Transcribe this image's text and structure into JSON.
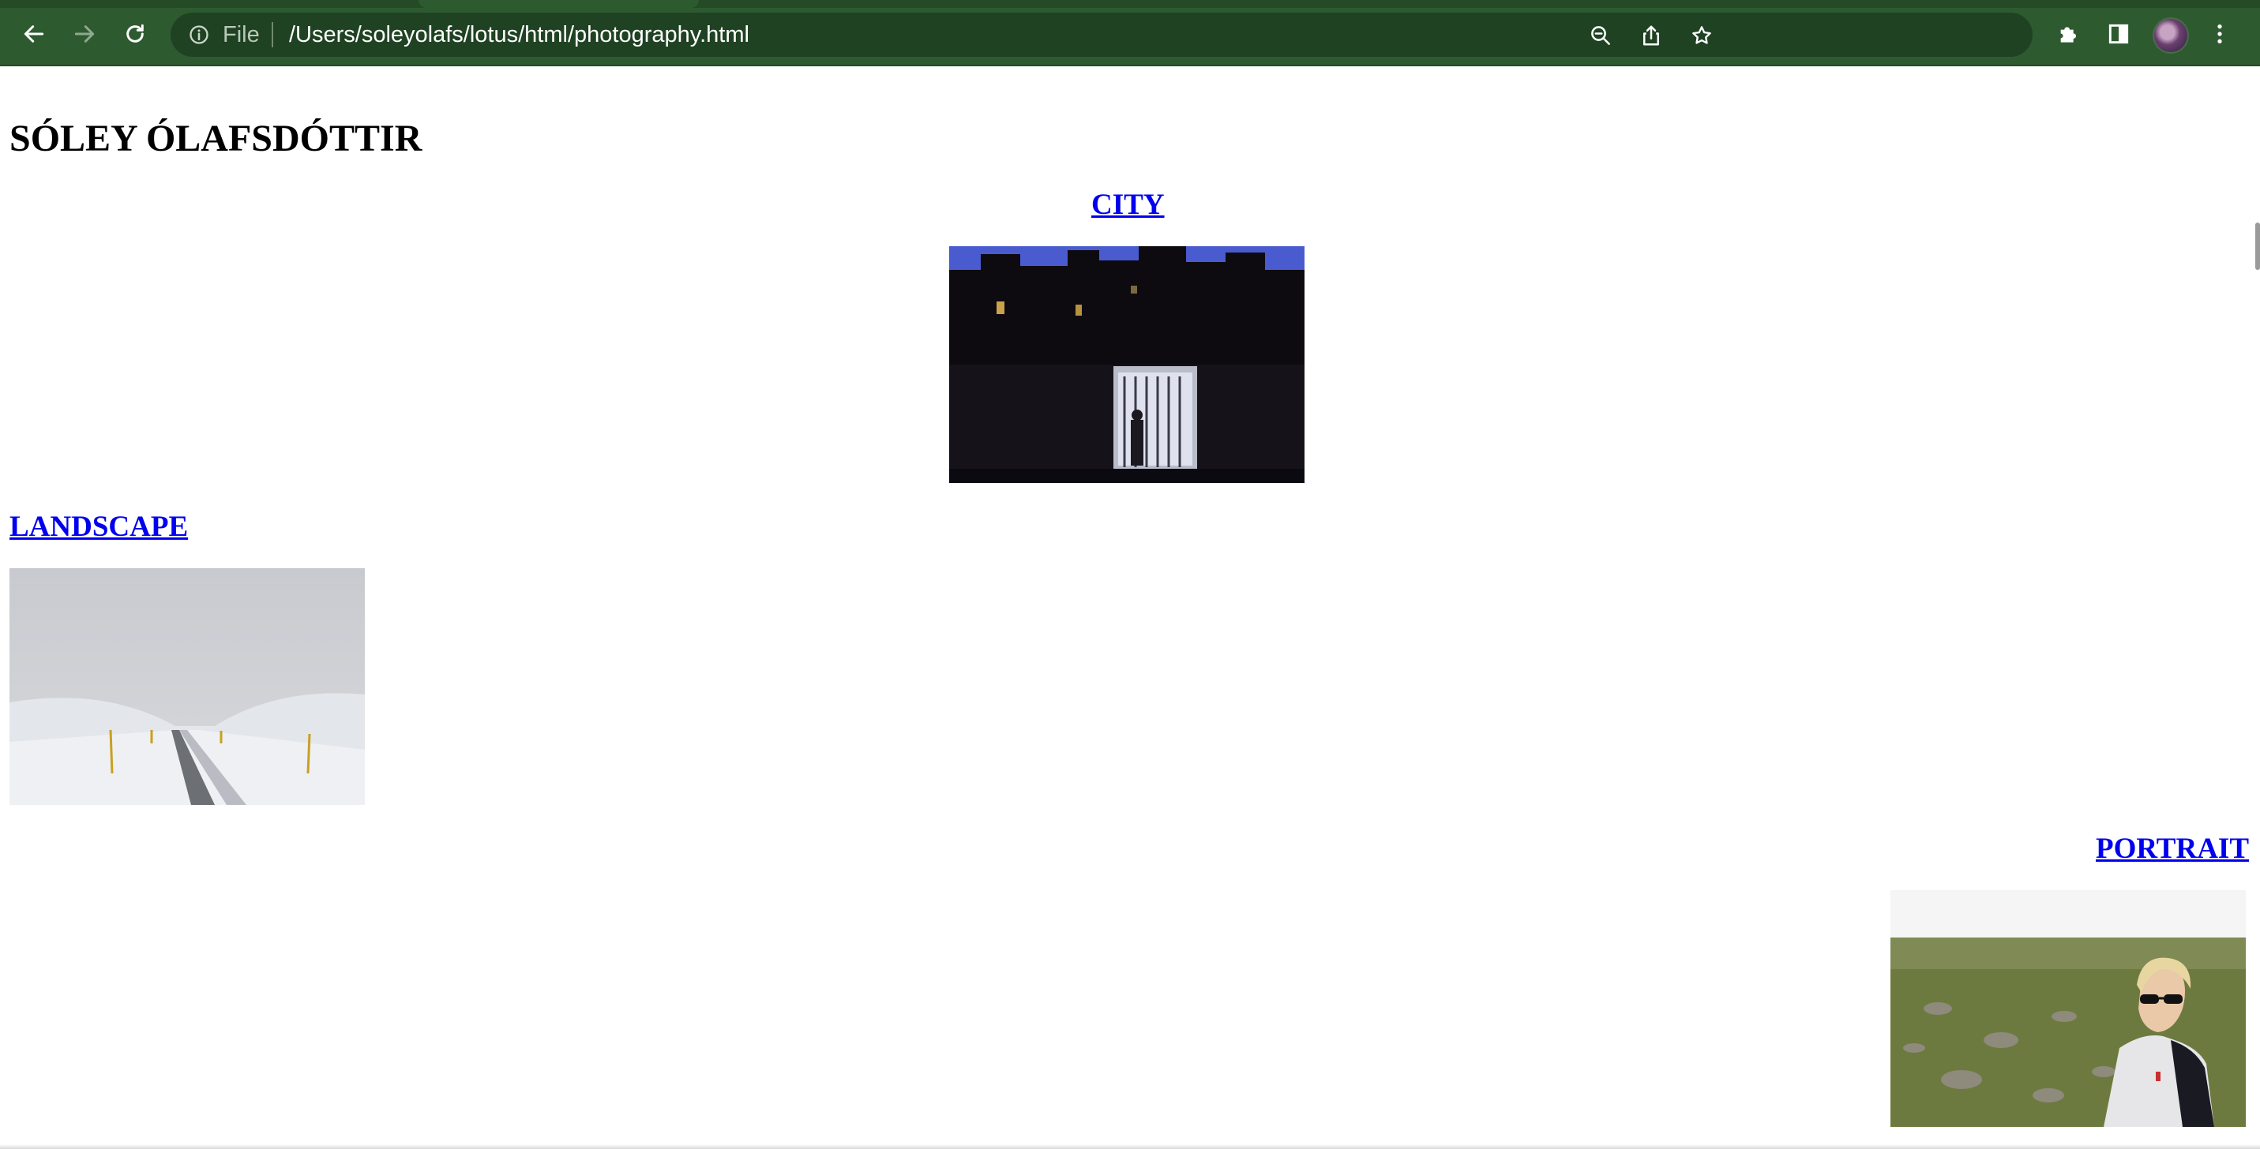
{
  "browser": {
    "scheme_label": "File",
    "url": "/Users/soleyolafs/lotus/html/photography.html",
    "theme_color": "#2e5a30"
  },
  "page": {
    "title": "SÓLEY ÓLAFSDÓTTIR",
    "sections": [
      {
        "id": "city",
        "label": "CITY",
        "image": "night city street photo"
      },
      {
        "id": "landscape",
        "label": "LANDSCAPE",
        "image": "snowy road landscape photo"
      },
      {
        "id": "portrait",
        "label": "PORTRAIT",
        "image": "portrait photo in a field"
      }
    ],
    "link_color": "#0000ee"
  },
  "icons": {
    "back": "arrow-left-icon",
    "forward": "arrow-right-icon",
    "reload": "reload-icon",
    "info": "info-icon",
    "zoom": "zoom-out-icon",
    "share": "share-icon",
    "bookmark": "star-icon",
    "extensions": "puzzle-icon",
    "side_panel": "side-panel-icon",
    "menu": "kebab-menu-icon"
  }
}
